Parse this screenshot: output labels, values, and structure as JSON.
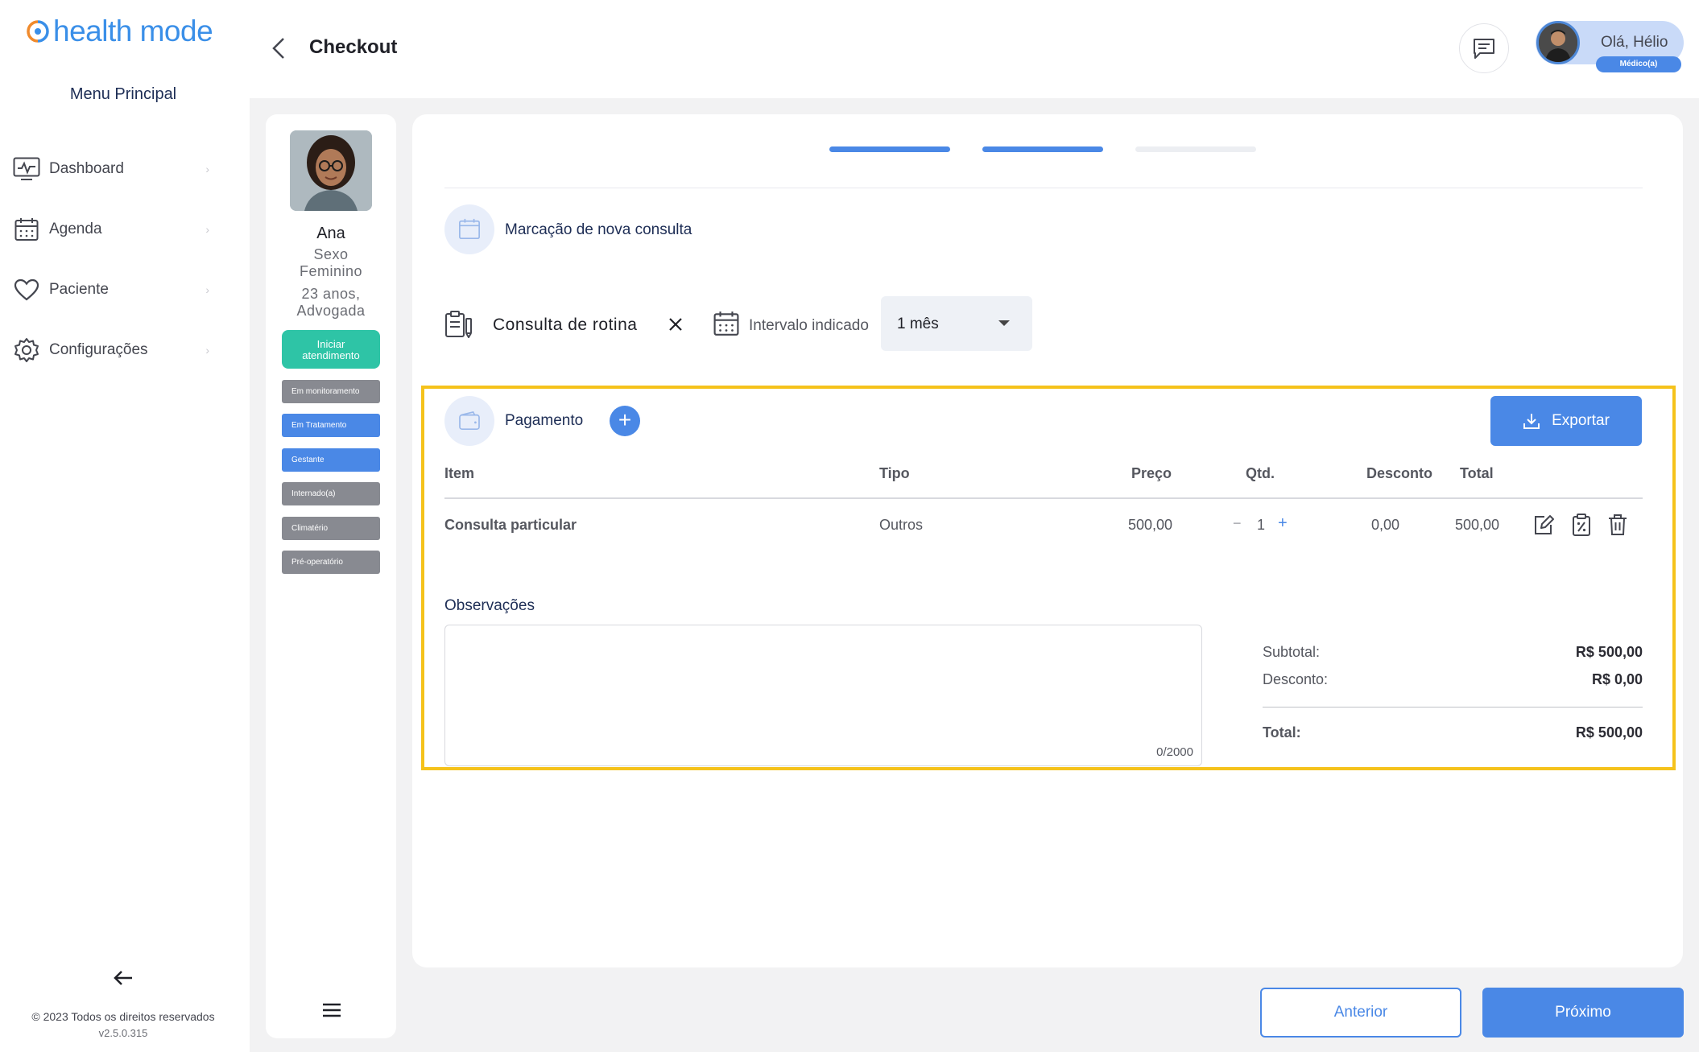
{
  "brand": {
    "name": "health mode",
    "color": "#3a8fe8"
  },
  "sidebar": {
    "title": "Menu Principal",
    "items": [
      {
        "label": "Dashboard",
        "icon": "monitor-icon"
      },
      {
        "label": "Agenda",
        "icon": "calendar-icon"
      },
      {
        "label": "Paciente",
        "icon": "heart-icon"
      },
      {
        "label": "Configurações",
        "icon": "gear-icon"
      }
    ],
    "copyright": "© 2023 Todos os direitos reservados",
    "version": "v2.5.0.315"
  },
  "header": {
    "title": "Checkout",
    "greeting": "Olá, Hélio",
    "role": "Médico(a)"
  },
  "patient": {
    "name": "Ana",
    "sex_line1": "Sexo",
    "sex_line2": "Feminino",
    "age_line1": "23 anos,",
    "age_line2": "Advogada",
    "start_line1": "Iniciar",
    "start_line2": "atendimento",
    "tags": [
      {
        "label": "Em monitoramento",
        "color": "#888a91"
      },
      {
        "label": "Em Tratamento",
        "color": "#4a88e6"
      },
      {
        "label": "Gestante",
        "color": "#4a88e6"
      },
      {
        "label": "Internado(a)",
        "color": "#888a91"
      },
      {
        "label": "Climatério",
        "color": "#888a91"
      },
      {
        "label": "Pré-operatório",
        "color": "#888a91"
      }
    ]
  },
  "checkout": {
    "steps_completed": 2,
    "steps_total": 3,
    "new_appointment_label": "Marcação de nova consulta",
    "consult_type": "Consulta de rotina",
    "interval_label": "Intervalo indicado",
    "interval_value": "1 mês",
    "payment": {
      "title": "Pagamento",
      "export_label": "Exportar",
      "columns": [
        "Item",
        "Tipo",
        "Preço",
        "Qtd.",
        "Desconto",
        "Total"
      ],
      "rows": [
        {
          "item": "Consulta particular",
          "tipo": "Outros",
          "preco": "500,00",
          "minus": "−",
          "qtd": "1",
          "plus": "+",
          "desconto": "0,00",
          "total": "500,00"
        }
      ],
      "observations_label": "Observações",
      "observations_counter": "0/2000",
      "subtotal_label": "Subtotal:",
      "subtotal_value": "R$ 500,00",
      "discount_label": "Desconto:",
      "discount_value": "R$ 0,00",
      "total_label": "Total:",
      "total_value": "R$ 500,00"
    }
  },
  "footer": {
    "prev_label": "Anterior",
    "next_label": "Próximo"
  },
  "colors": {
    "primary": "#4a88e6",
    "success": "#2ec4a6",
    "highlight": "#f5c21b"
  }
}
